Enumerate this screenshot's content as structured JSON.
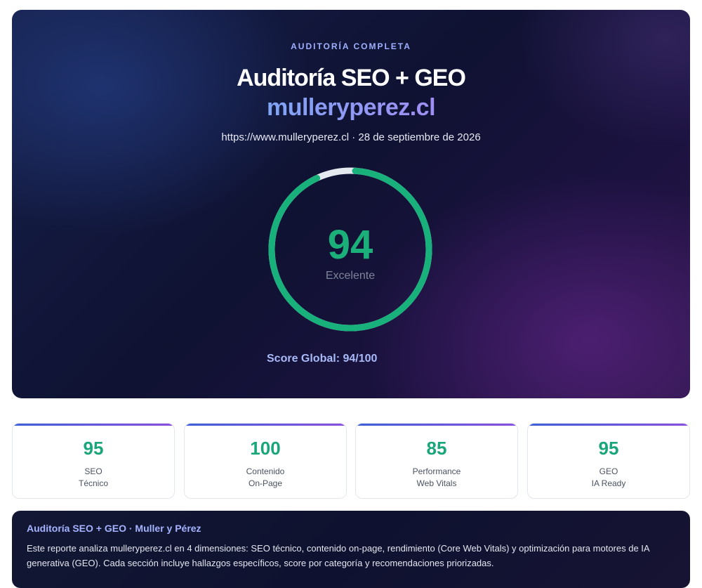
{
  "hero": {
    "eyebrow": "AUDITORÍA COMPLETA",
    "title": "Auditoría SEO + GEO",
    "domain": "mulleryperez.cl",
    "meta": "https://www.mulleryperez.cl · 28 de septiembre de 2026",
    "score": {
      "value": "94",
      "fraction": 0.94,
      "label": "Excelente",
      "color": "#18b07b",
      "track_color": "#e5e9f0"
    },
    "score_global": "Score Global: 94/100"
  },
  "cards": [
    {
      "value": "95",
      "line1": "SEO",
      "line2": "Técnico"
    },
    {
      "value": "100",
      "line1": "Contenido",
      "line2": "On-Page"
    },
    {
      "value": "85",
      "line1": "Performance",
      "line2": "Web Vitals"
    },
    {
      "value": "95",
      "line1": "GEO",
      "line2": "IA Ready"
    }
  ],
  "summary": {
    "title": "Auditoría SEO + GEO · Muller y Pérez",
    "body": "Este reporte analiza mulleryperez.cl en 4 dimensiones: SEO técnico, contenido on-page, rendimiento (Core Web Vitals) y optimización para motores de IA generativa (GEO). Cada sección incluye hallazgos específicos, score por categoría y recomendaciones priorizadas."
  }
}
